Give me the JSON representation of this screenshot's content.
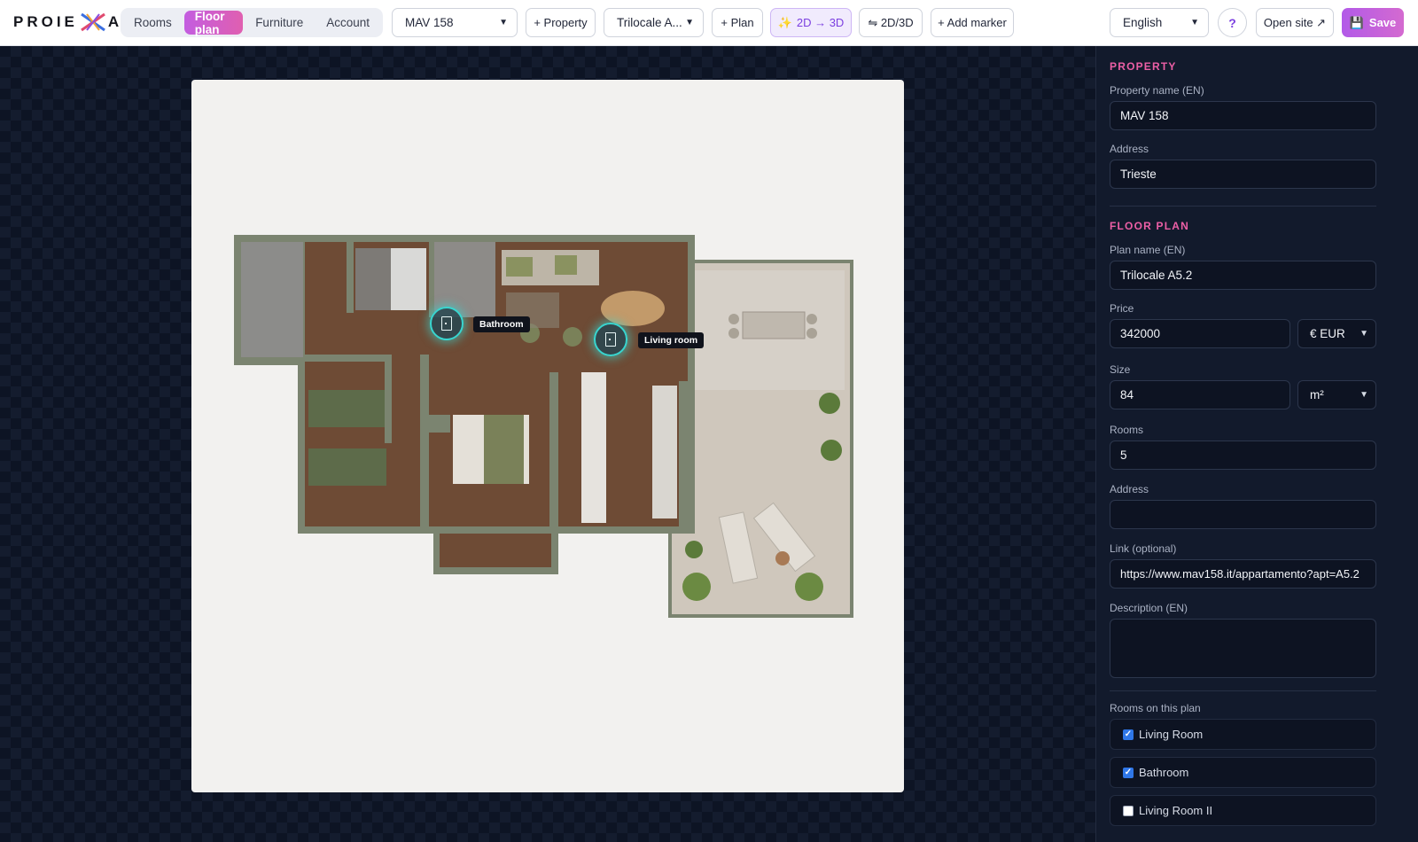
{
  "app": {
    "logo_left": "PROIE",
    "logo_right": "A"
  },
  "nav": {
    "tabs": [
      {
        "label": "Rooms",
        "active": false
      },
      {
        "label": "Floor plan",
        "active": true
      },
      {
        "label": "Furniture",
        "active": false
      },
      {
        "label": "Account",
        "active": false
      }
    ]
  },
  "toolbar": {
    "property_select": "MAV 158",
    "add_property": "+ Property",
    "plan_select": "Trilocale A...",
    "add_plan": "+ Plan",
    "convert_3d": "2D → 3D",
    "toggle_2d3d": "⇋ 2D/3D",
    "add_marker": "+ Add marker",
    "language_select": "English",
    "help": "?",
    "open_site": "Open site ↗",
    "save": "Save"
  },
  "markers": [
    {
      "label": "Bathroom"
    },
    {
      "label": "Living room"
    }
  ],
  "panel": {
    "property_section": "PROPERTY",
    "property_name_label": "Property name (EN)",
    "property_name_value": "MAV 158",
    "address_label": "Address",
    "address_value": "Trieste",
    "floor_plan_section": "FLOOR PLAN",
    "plan_name_label": "Plan name (EN)",
    "plan_name_value": "Trilocale A5.2",
    "price_label": "Price",
    "price_value": "342000",
    "currency_value": "€ EUR",
    "size_label": "Size",
    "size_value": "84",
    "unit_value": "m²",
    "rooms_label": "Rooms",
    "rooms_value": "5",
    "plan_address_label": "Address",
    "plan_address_value": "",
    "link_label": "Link (optional)",
    "link_value": "https://www.mav158.it/appartamento?apt=A5.2",
    "description_label": "Description (EN)",
    "description_value": "",
    "rooms_on_plan_label": "Rooms on this plan",
    "rooms_on_plan": [
      {
        "label": "Living Room",
        "checked": true
      },
      {
        "label": "Bathroom",
        "checked": true
      },
      {
        "label": "Living Room II",
        "checked": false
      }
    ]
  },
  "colors": {
    "accent_pink": "#ec5fa6",
    "accent_purple": "#7b3fe0",
    "marker_glow": "#38d6d0",
    "panel_bg": "#121a2c",
    "wall_green": "#7b8470",
    "floor_wood": "#6e4b35"
  }
}
